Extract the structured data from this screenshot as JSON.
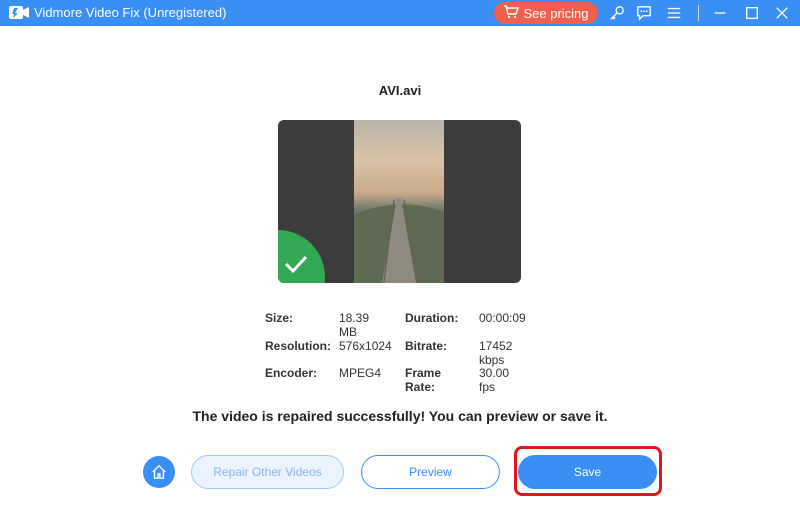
{
  "titlebar": {
    "app_title": "Vidmore Video Fix (Unregistered)",
    "pricing_label": "See pricing",
    "icons": [
      "cart-icon",
      "key-icon",
      "feedback-icon",
      "menu-icon",
      "minimize-icon",
      "maximize-icon",
      "close-icon"
    ]
  },
  "file": {
    "name": "AVI.avi"
  },
  "info": {
    "size_label": "Size:",
    "size_value": "18.39 MB",
    "duration_label": "Duration:",
    "duration_value": "00:00:09",
    "resolution_label": "Resolution:",
    "resolution_value": "576x1024",
    "bitrate_label": "Bitrate:",
    "bitrate_value": "17452 kbps",
    "encoder_label": "Encoder:",
    "encoder_value": "MPEG4",
    "framerate_label": "Frame Rate:",
    "framerate_value": "30.00 fps"
  },
  "message": "The video is repaired successfully! You can preview or save it.",
  "buttons": {
    "repair_label": "Repair Other Videos",
    "preview_label": "Preview",
    "save_label": "Save"
  },
  "colors": {
    "accent": "#3a8ff5",
    "pricing": "#f25f4c",
    "success": "#32a852",
    "highlight": "#e0161f"
  }
}
